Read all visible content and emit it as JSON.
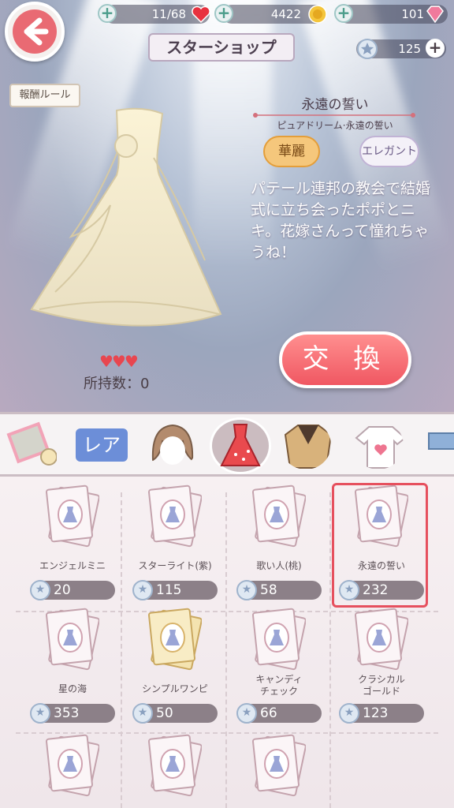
{
  "topbar": {
    "hearts": "11/68",
    "gold": "4422",
    "diamonds": "101",
    "stars": "125"
  },
  "title": "スターショップ",
  "rule_button": "報酬ルール",
  "item": {
    "name": "永遠の誓い",
    "subtitle": "ピュアドリーム·永遠の誓い",
    "tag1": "華麗",
    "tag2": "エレガント",
    "description": "パテール連邦の教会で結婚式に立ち会ったポポとニキ。花嫁さんって憧れちゃうね！",
    "hearts": "♥♥♥",
    "owned": "所持数：0",
    "exchange_label": "交 換"
  },
  "tabs": {
    "rare_label": "レア"
  },
  "products": [
    {
      "name": "エンジェルミニ",
      "price": "20"
    },
    {
      "name": "スターライト(紫)",
      "price": "115"
    },
    {
      "name": "歌い人(桃)",
      "price": "58"
    },
    {
      "name": "永遠の誓い",
      "price": "232"
    },
    {
      "name": "星の海",
      "price": "353"
    },
    {
      "name": "シンプルワンピ",
      "price": "50"
    },
    {
      "name": "キャンディ チェック",
      "price": "66"
    },
    {
      "name": "クラシカル ゴールド",
      "price": "123"
    }
  ],
  "colors": {
    "accent": "#e96a73",
    "selected_border": "#e6505e",
    "price_badge": "#8c8088"
  }
}
